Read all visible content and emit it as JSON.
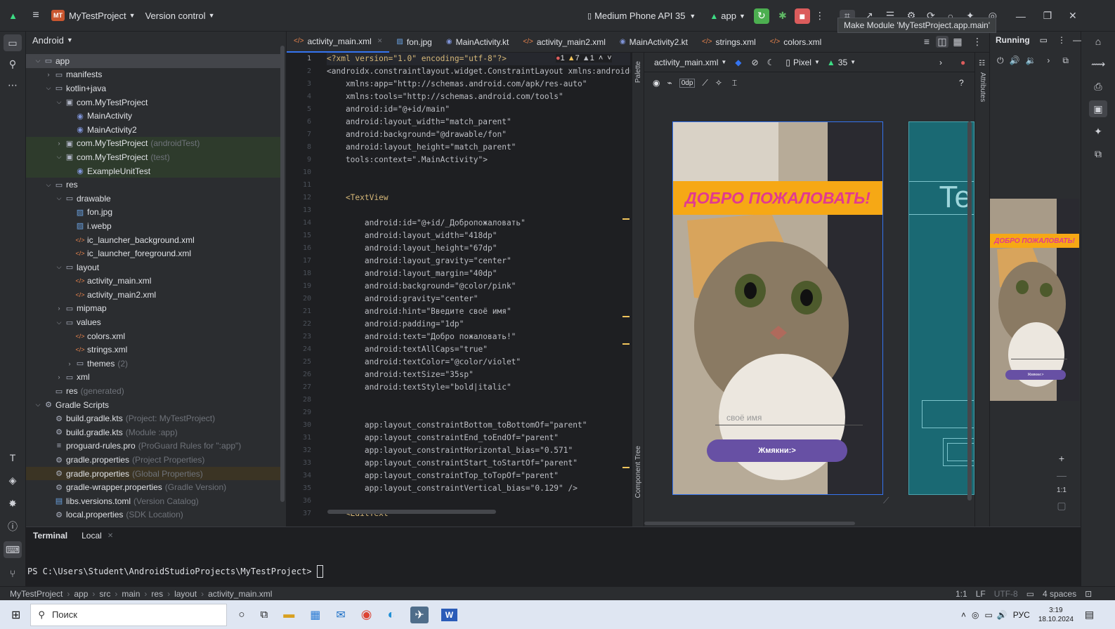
{
  "topbar": {
    "project_badge": "MT",
    "project": "MyTestProject",
    "vcs": "Version control",
    "device": "Medium Phone API 35",
    "config": "app",
    "tooltip": "Make Module 'MyTestProject.app.main'"
  },
  "project_panel": {
    "view": "Android",
    "items": [
      {
        "label": "app",
        "dim": "",
        "depth": 0,
        "arrow": "v",
        "icon": "folder"
      },
      {
        "label": "manifests",
        "dim": "",
        "depth": 1,
        "arrow": ">",
        "icon": "folder"
      },
      {
        "label": "kotlin+java",
        "dim": "",
        "depth": 1,
        "arrow": "v",
        "icon": "folder"
      },
      {
        "label": "com.MyTestProject",
        "dim": "",
        "depth": 2,
        "arrow": "v",
        "icon": "package"
      },
      {
        "label": "MainActivity",
        "dim": "",
        "depth": 3,
        "arrow": "",
        "icon": "kotlin"
      },
      {
        "label": "MainActivity2",
        "dim": "",
        "depth": 3,
        "arrow": "",
        "icon": "kotlin"
      },
      {
        "label": "com.MyTestProject",
        "dim": "(androidTest)",
        "depth": 2,
        "arrow": ">",
        "icon": "package"
      },
      {
        "label": "com.MyTestProject",
        "dim": "(test)",
        "depth": 2,
        "arrow": "v",
        "icon": "package"
      },
      {
        "label": "ExampleUnitTest",
        "dim": "",
        "depth": 3,
        "arrow": "",
        "icon": "kotlin"
      },
      {
        "label": "res",
        "dim": "",
        "depth": 1,
        "arrow": "v",
        "icon": "folder"
      },
      {
        "label": "drawable",
        "dim": "",
        "depth": 2,
        "arrow": "v",
        "icon": "folder"
      },
      {
        "label": "fon.jpg",
        "dim": "",
        "depth": 3,
        "arrow": "",
        "icon": "image"
      },
      {
        "label": "i.webp",
        "dim": "",
        "depth": 3,
        "arrow": "",
        "icon": "image"
      },
      {
        "label": "ic_launcher_background.xml",
        "dim": "",
        "depth": 3,
        "arrow": "",
        "icon": "xml"
      },
      {
        "label": "ic_launcher_foreground.xml",
        "dim": "",
        "depth": 3,
        "arrow": "",
        "icon": "xml"
      },
      {
        "label": "layout",
        "dim": "",
        "depth": 2,
        "arrow": "v",
        "icon": "folder"
      },
      {
        "label": "activity_main.xml",
        "dim": "",
        "depth": 3,
        "arrow": "",
        "icon": "xml"
      },
      {
        "label": "activity_main2.xml",
        "dim": "",
        "depth": 3,
        "arrow": "",
        "icon": "xml"
      },
      {
        "label": "mipmap",
        "dim": "",
        "depth": 2,
        "arrow": ">",
        "icon": "folder"
      },
      {
        "label": "values",
        "dim": "",
        "depth": 2,
        "arrow": "v",
        "icon": "folder"
      },
      {
        "label": "colors.xml",
        "dim": "",
        "depth": 3,
        "arrow": "",
        "icon": "xml"
      },
      {
        "label": "strings.xml",
        "dim": "",
        "depth": 3,
        "arrow": "",
        "icon": "xml"
      },
      {
        "label": "themes",
        "dim": "(2)",
        "depth": 3,
        "arrow": ">",
        "icon": "folder"
      },
      {
        "label": "xml",
        "dim": "",
        "depth": 2,
        "arrow": ">",
        "icon": "folder"
      },
      {
        "label": "res",
        "dim": "(generated)",
        "depth": 1,
        "arrow": "",
        "icon": "folder"
      },
      {
        "label": "Gradle Scripts",
        "dim": "",
        "depth": 0,
        "arrow": "v",
        "icon": "gradle"
      },
      {
        "label": "build.gradle.kts",
        "dim": "(Project: MyTestProject)",
        "depth": 1,
        "arrow": "",
        "icon": "gradle"
      },
      {
        "label": "build.gradle.kts",
        "dim": "(Module :app)",
        "depth": 1,
        "arrow": "",
        "icon": "gradle"
      },
      {
        "label": "proguard-rules.pro",
        "dim": "(ProGuard Rules for \":app\")",
        "depth": 1,
        "arrow": "",
        "icon": "lines"
      },
      {
        "label": "gradle.properties",
        "dim": "(Project Properties)",
        "depth": 1,
        "arrow": "",
        "icon": "gear"
      },
      {
        "label": "gradle.properties",
        "dim": "(Global Properties)",
        "depth": 1,
        "arrow": "",
        "icon": "gear"
      },
      {
        "label": "gradle-wrapper.properties",
        "dim": "(Gradle Version)",
        "depth": 1,
        "arrow": "",
        "icon": "gear"
      },
      {
        "label": "libs.versions.toml",
        "dim": "(Version Catalog)",
        "depth": 1,
        "arrow": "",
        "icon": "toml"
      },
      {
        "label": "local.properties",
        "dim": "(SDK Location)",
        "depth": 1,
        "arrow": "",
        "icon": "gear"
      }
    ]
  },
  "tabs": [
    "activity_main.xml",
    "fon.jpg",
    "MainActivity.kt",
    "activity_main2.xml",
    "MainActivity2.kt",
    "strings.xml",
    "colors.xml"
  ],
  "inspections": {
    "errors": "1",
    "warnings": "7",
    "weak": "1"
  },
  "code_lines": [
    "<?xml version=\"1.0\" encoding=\"utf-8\"?>",
    "<androidx.constraintlayout.widget.ConstraintLayout xmlns:android=\"",
    "    xmlns:app=\"http://schemas.android.com/apk/res-auto\"",
    "    xmlns:tools=\"http://schemas.android.com/tools\"",
    "    android:id=\"@+id/main\"",
    "    android:layout_width=\"match_parent\"",
    "    android:background=\"@drawable/fon\"",
    "    android:layout_height=\"match_parent\"",
    "    tools:context=\".MainActivity\">",
    "",
    "",
    "    <TextView",
    "",
    "        android:id=\"@+id/_Добропожаловать\"",
    "        android:layout_width=\"418dp\"",
    "        android:layout_height=\"67dp\"",
    "        android:layout_gravity=\"center\"",
    "        android:layout_margin=\"40dp\"",
    "        android:background=\"@color/pink\"",
    "        android:gravity=\"center\"",
    "        android:hint=\"Введите своё имя\"",
    "        android:padding=\"1dp\"",
    "        android:text=\"Добро пожаловать!\"",
    "        android:textAllCaps=\"true\"",
    "        android:textColor=\"@color/violet\"",
    "        android:textSize=\"35sp\"",
    "        android:textStyle=\"bold|italic\"",
    "",
    "",
    "        app:layout_constraintBottom_toBottomOf=\"parent\"",
    "        app:layout_constraintEnd_toEndOf=\"parent\"",
    "        app:layout_constraintHorizontal_bias=\"0.571\"",
    "        app:layout_constraintStart_toStartOf=\"parent\"",
    "        app:layout_constraintTop_toTopOf=\"parent\"",
    "        app:layout_constraintVertical_bias=\"0.129\" />",
    "",
    "    <EditText"
  ],
  "design": {
    "file": "activity_main.xml",
    "device": "Pixel",
    "api": "35",
    "margin": "0dp",
    "palette": "Palette",
    "component_tree": "Component Tree",
    "attributes": "Attributes",
    "welcome": "ДОБРО ПОЖАЛОВАТЬ!",
    "hint": "своё имя",
    "button": "Жмякни:>",
    "zoom": "1:1",
    "blueprint_text": "Te"
  },
  "running": {
    "title": "Running",
    "welcome": "ДОБРО ПОЖАЛОВАТЬ!",
    "button": "Жмякни:>"
  },
  "terminal": {
    "tab1": "Terminal",
    "tab2": "Local",
    "prompt": "PS C:\\Users\\Student\\AndroidStudioProjects\\MyTestProject> "
  },
  "status": {
    "breadcrumb": [
      "MyTestProject",
      "app",
      "src",
      "main",
      "res",
      "layout",
      "activity_main.xml"
    ],
    "position": "1:1",
    "lf": "LF",
    "encoding": "UTF-8",
    "indent": "4 spaces"
  },
  "taskbar": {
    "search": "Поиск",
    "lang": "РУС",
    "time": "3:19",
    "date": "18.10.2024"
  }
}
